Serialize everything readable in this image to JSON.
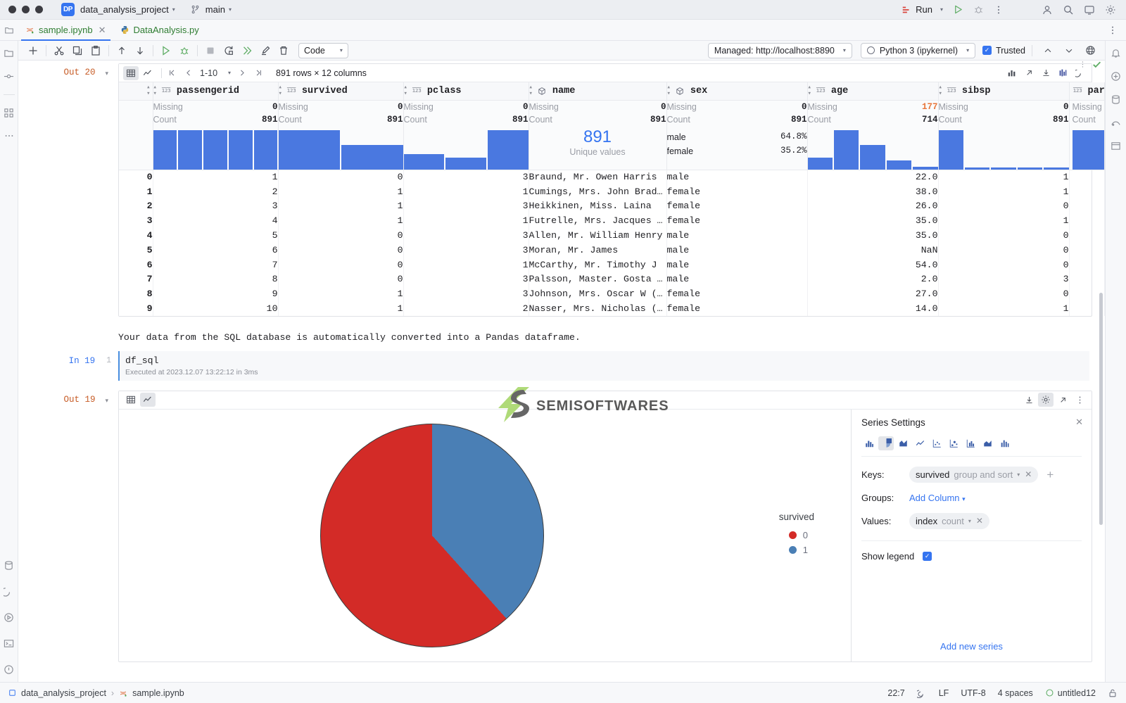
{
  "titlebar": {
    "project_badge": "DP",
    "project_name": "data_analysis_project",
    "branch": "main",
    "run_label": "Run"
  },
  "tabs": [
    {
      "label": "sample.ipynb",
      "icon": "jupyter-icon",
      "active": true,
      "closable": true
    },
    {
      "label": "DataAnalysis.py",
      "icon": "python-icon",
      "active": false,
      "closable": false
    }
  ],
  "notebook_toolbar": {
    "cell_type": "Code",
    "server": "Managed: http://localhost:8890",
    "kernel": "Python 3 (ipykernel)",
    "trusted_label": "Trusted",
    "trusted_checked": true
  },
  "output_20": {
    "label": "Out 20",
    "pager": "1-10",
    "dimensions": "891 rows × 12 columns",
    "columns": [
      {
        "name": "passengerid",
        "type": "number",
        "missing": "0",
        "count": "891",
        "missing_warn": false,
        "hist": [
          100,
          100,
          100,
          100,
          100
        ]
      },
      {
        "name": "survived",
        "type": "number",
        "missing": "0",
        "count": "891",
        "missing_warn": false,
        "hist": [
          100,
          62
        ]
      },
      {
        "name": "pclass",
        "type": "number",
        "missing": "0",
        "count": "891",
        "missing_warn": false,
        "hist": [
          38,
          30,
          100
        ]
      },
      {
        "name": "name",
        "type": "object",
        "missing": "0",
        "count": "891",
        "missing_warn": false,
        "unique_value": "891",
        "unique_label": "Unique values"
      },
      {
        "name": "sex",
        "type": "object",
        "missing": "0",
        "count": "891",
        "missing_warn": false,
        "categories": [
          {
            "label": "male",
            "pct": "64.8%"
          },
          {
            "label": "female",
            "pct": "35.2%"
          }
        ]
      },
      {
        "name": "age",
        "type": "number",
        "missing": "177",
        "count": "714",
        "missing_warn": true,
        "hist": [
          38,
          100,
          62,
          22,
          8
        ]
      },
      {
        "name": "sibsp",
        "type": "number",
        "missing": "0",
        "count": "891",
        "missing_warn": false,
        "hist": [
          100,
          5,
          5,
          5,
          5
        ]
      },
      {
        "name": "par",
        "type": "number",
        "missing": "",
        "count": "",
        "missing_warn": false,
        "hist": [
          100
        ]
      }
    ],
    "rows": [
      {
        "index": "0",
        "passengerid": "1",
        "survived": "0",
        "pclass": "3",
        "name": "Braund, Mr. Owen Harris",
        "sex": "male",
        "age": "22.0",
        "sibsp": "1"
      },
      {
        "index": "1",
        "passengerid": "2",
        "survived": "1",
        "pclass": "1",
        "name": "Cumings, Mrs. John Brad…",
        "sex": "female",
        "age": "38.0",
        "sibsp": "1"
      },
      {
        "index": "2",
        "passengerid": "3",
        "survived": "1",
        "pclass": "3",
        "name": "Heikkinen, Miss. Laina",
        "sex": "female",
        "age": "26.0",
        "sibsp": "0"
      },
      {
        "index": "3",
        "passengerid": "4",
        "survived": "1",
        "pclass": "1",
        "name": "Futrelle, Mrs. Jacques …",
        "sex": "female",
        "age": "35.0",
        "sibsp": "1"
      },
      {
        "index": "4",
        "passengerid": "5",
        "survived": "0",
        "pclass": "3",
        "name": "Allen, Mr. William Henry",
        "sex": "male",
        "age": "35.0",
        "sibsp": "0"
      },
      {
        "index": "5",
        "passengerid": "6",
        "survived": "0",
        "pclass": "3",
        "name": "Moran, Mr. James",
        "sex": "male",
        "age": "NaN",
        "sibsp": "0"
      },
      {
        "index": "6",
        "passengerid": "7",
        "survived": "0",
        "pclass": "1",
        "name": "McCarthy, Mr. Timothy J",
        "sex": "male",
        "age": "54.0",
        "sibsp": "0"
      },
      {
        "index": "7",
        "passengerid": "8",
        "survived": "0",
        "pclass": "3",
        "name": "Palsson, Master. Gosta …",
        "sex": "male",
        "age": "2.0",
        "sibsp": "3"
      },
      {
        "index": "8",
        "passengerid": "9",
        "survived": "1",
        "pclass": "3",
        "name": "Johnson, Mrs. Oscar W (…",
        "sex": "female",
        "age": "27.0",
        "sibsp": "0"
      },
      {
        "index": "9",
        "passengerid": "10",
        "survived": "1",
        "pclass": "2",
        "name": "Nasser, Mrs. Nicholas (…",
        "sex": "female",
        "age": "14.0",
        "sibsp": "1"
      }
    ]
  },
  "markdown": {
    "text": "Your data from the SQL database is automatically converted into a Pandas dataframe."
  },
  "input_19": {
    "label": "In 19",
    "line_number": "1",
    "code": "df_sql",
    "exec_info": "Executed at 2023.12.07 13:22:12 in 3ms"
  },
  "output_19": {
    "label": "Out 19"
  },
  "series_settings": {
    "title": "Series Settings",
    "keys_label": "Keys:",
    "keys_chip_main": "survived",
    "keys_chip_sub": "group and sort",
    "groups_label": "Groups:",
    "groups_add": "Add Column",
    "values_label": "Values:",
    "values_chip_main": "index",
    "values_chip_sub": "count",
    "show_legend_label": "Show legend",
    "show_legend_checked": true,
    "add_new_series": "Add new series",
    "chart_type_selected": "pie"
  },
  "chart_data": {
    "type": "pie",
    "title": "",
    "legend_title": "survived",
    "legend_position": "right",
    "categories": [
      "0",
      "1"
    ],
    "values": [
      549,
      342
    ],
    "percentages": [
      61.6,
      38.4
    ],
    "colors": [
      "#d32b27",
      "#4a7fb5"
    ],
    "labels": [
      "0",
      "1"
    ]
  },
  "watermark": {
    "text_a": "SEMI",
    "text_b": "SOFTWARES"
  },
  "statusbar": {
    "crumb_project": "data_analysis_project",
    "crumb_file": "sample.ipynb",
    "caret": "22:7",
    "line_sep": "LF",
    "encoding": "UTF-8",
    "indent": "4 spaces",
    "interpreter": "untitled12"
  },
  "colors": {
    "accent_blue": "#3574f0",
    "hist_blue": "#4a78e0",
    "pie_red": "#d32b27",
    "pie_blue": "#4a7fb5",
    "warn_orange": "#e8763a",
    "out_label": "#c75c26"
  }
}
